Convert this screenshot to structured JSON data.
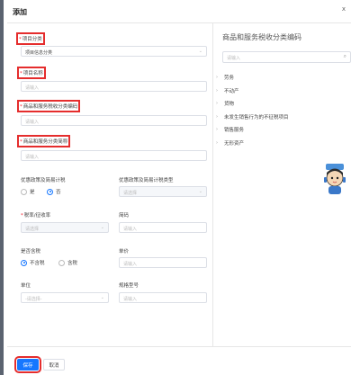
{
  "dialog": {
    "title": "添加",
    "close": "x"
  },
  "form": {
    "category": {
      "label": "项目分类",
      "value": "项目信息分类"
    },
    "name": {
      "label": "项目名称",
      "placeholder": "请输入"
    },
    "tax_code": {
      "label": "商品和服务税收分类编码",
      "placeholder": "请输入"
    },
    "tax_abbr": {
      "label": "商品和服务分类简称",
      "placeholder": "请输入"
    },
    "preferential": {
      "label": "优惠政策及简易计税",
      "options": [
        "是",
        "否"
      ],
      "selected": "否"
    },
    "preferential_type": {
      "label": "优惠政策及简易计税类型",
      "placeholder": "请选择"
    },
    "tax_rate": {
      "label": "税率/征收率",
      "placeholder": "请选择"
    },
    "short_code": {
      "label": "简码",
      "placeholder": "请输入"
    },
    "tax_included": {
      "label": "是否含税",
      "options": [
        "不含税",
        "含税"
      ],
      "selected": "不含税"
    },
    "unit_price": {
      "label": "单价",
      "placeholder": "请输入"
    },
    "unit": {
      "label": "单位",
      "placeholder": "-请选择-"
    },
    "spec": {
      "label": "规格型号",
      "placeholder": "请输入"
    }
  },
  "tax_tree": {
    "title": "商品和服务税收分类编码",
    "search_placeholder": "请输入",
    "items": [
      "劳务",
      "不动产",
      "货物",
      "未发生销售行为的不征税项目",
      "销售服务",
      "无形资产"
    ]
  },
  "footer": {
    "save": "保存",
    "cancel": "取消"
  },
  "colors": {
    "primary": "#1677ff",
    "highlight": "#e52d2d",
    "required": "#f5222d"
  }
}
